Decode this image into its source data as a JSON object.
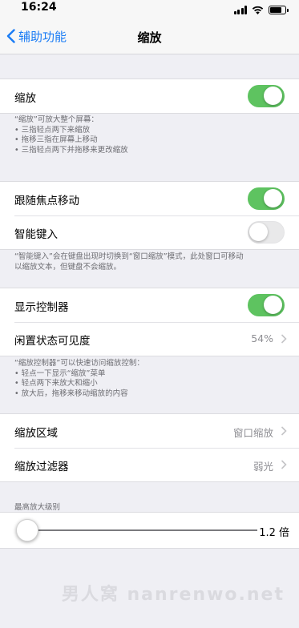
{
  "status_bar": {
    "time": "16:24",
    "battery_level": 0.8
  },
  "nav": {
    "back_label": "辅助功能",
    "title": "缩放"
  },
  "zoom_row": {
    "label": "缩放",
    "toggle_on": true
  },
  "zoom_footer": {
    "lines": [
      "“缩放”可放大整个屏幕：",
      "• 三指轻点两下来缩放",
      "• 拖移三指在屏幕上移动",
      "• 三指轻点两下并拖移来更改缩放"
    ]
  },
  "focus_row": {
    "label": "跟随焦点移动",
    "toggle_on": true
  },
  "smart_typing_row": {
    "label": "智能键入",
    "toggle_on": false
  },
  "smart_typing_footer": {
    "lines": [
      "“智能键入”会在键盘出现时切换到“窗口缩放”模式，此处窗口可移动",
      "以缩放文本，但键盘不会缩放。"
    ]
  },
  "controller_row": {
    "label": "显示控制器",
    "toggle_on": true
  },
  "idle_visibility_row": {
    "label": "闲置状态可见度",
    "value": "54%"
  },
  "controller_footer": {
    "lines": [
      "“缩放控制器”可以快速访问缩放控制：",
      "• 轻点一下显示“缩放”菜单",
      "• 轻点两下来放大和缩小",
      "• 放大后，拖移来移动缩放的内容"
    ]
  },
  "zoom_region_row": {
    "label": "缩放区域",
    "value": "窗口缩放"
  },
  "zoom_filter_row": {
    "label": "缩放过滤器",
    "value": "弱光"
  },
  "max_zoom": {
    "header": "最高放大级别",
    "value": "1.2 倍",
    "slider_fraction": 0.0
  },
  "watermark": "男人窝 nanrenwo.net"
}
